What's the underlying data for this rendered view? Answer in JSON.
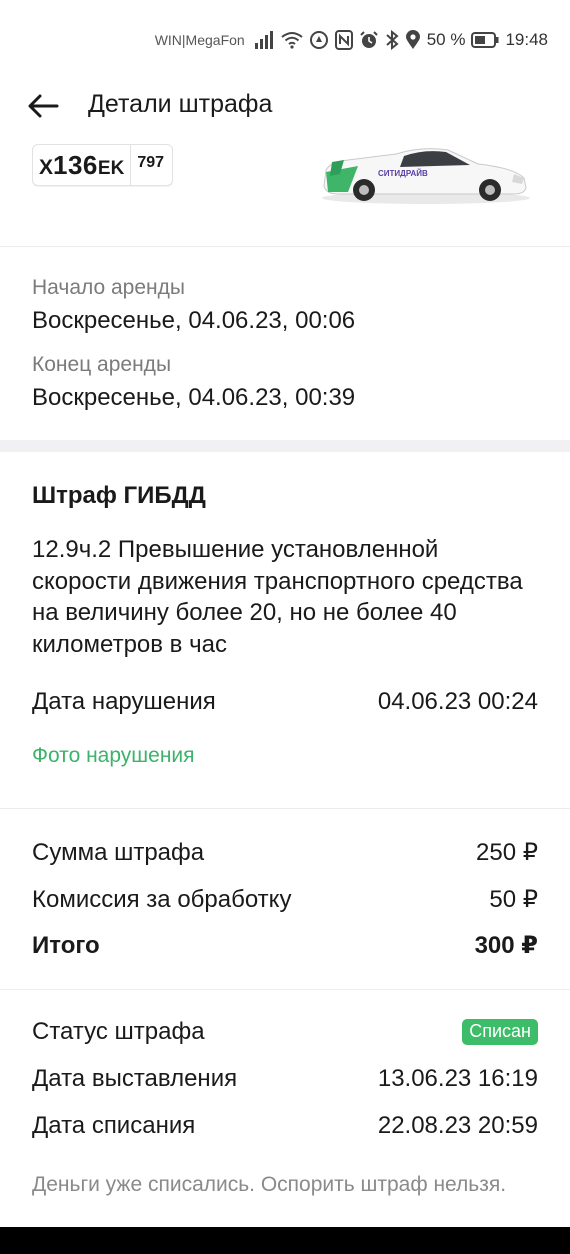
{
  "status_bar": {
    "carrier": "WIN|MegaFon",
    "battery": "50 %",
    "time": "19:48"
  },
  "header": {
    "title": "Детали штрафа",
    "back_icon": "arrow-left-icon"
  },
  "car": {
    "plate_letter1": "X",
    "plate_number": "136",
    "plate_letters2": "EK",
    "plate_region": "797",
    "brand_text": "СИТИДРАЙВ"
  },
  "rental": {
    "start_label": "Начало аренды",
    "start_value": "Воскресенье, 04.06.23, 00:06",
    "end_label": "Конец аренды",
    "end_value": "Воскресенье, 04.06.23, 00:39"
  },
  "fine": {
    "title": "Штраф ГИБДД",
    "description": "12.9ч.2 Превышение установленной скорости движения транспортного средства на величину более 20, но не более 40 километров в час",
    "violation_date_label": "Дата нарушения",
    "violation_date_value": "04.06.23 00:24",
    "photo_link": "Фото нарушения"
  },
  "amounts": {
    "fine_label": "Сумма штрафа",
    "fine_value": "250 ₽",
    "commission_label": "Комиссия за обработку",
    "commission_value": "50 ₽",
    "total_label": "Итого",
    "total_value": "300 ₽"
  },
  "status": {
    "status_label": "Статус штрафа",
    "status_badge": "Списан",
    "issued_label": "Дата выставления",
    "issued_value": "13.06.23 16:19",
    "charged_label": "Дата списания",
    "charged_value": "22.08.23 20:59",
    "note": "Деньги уже списались. Оспорить штраф нельзя."
  },
  "colors": {
    "accent_green": "#3dbc6a",
    "link_green": "#3cb36a",
    "text": "#1a1a1a",
    "muted": "#7b7b7b"
  }
}
